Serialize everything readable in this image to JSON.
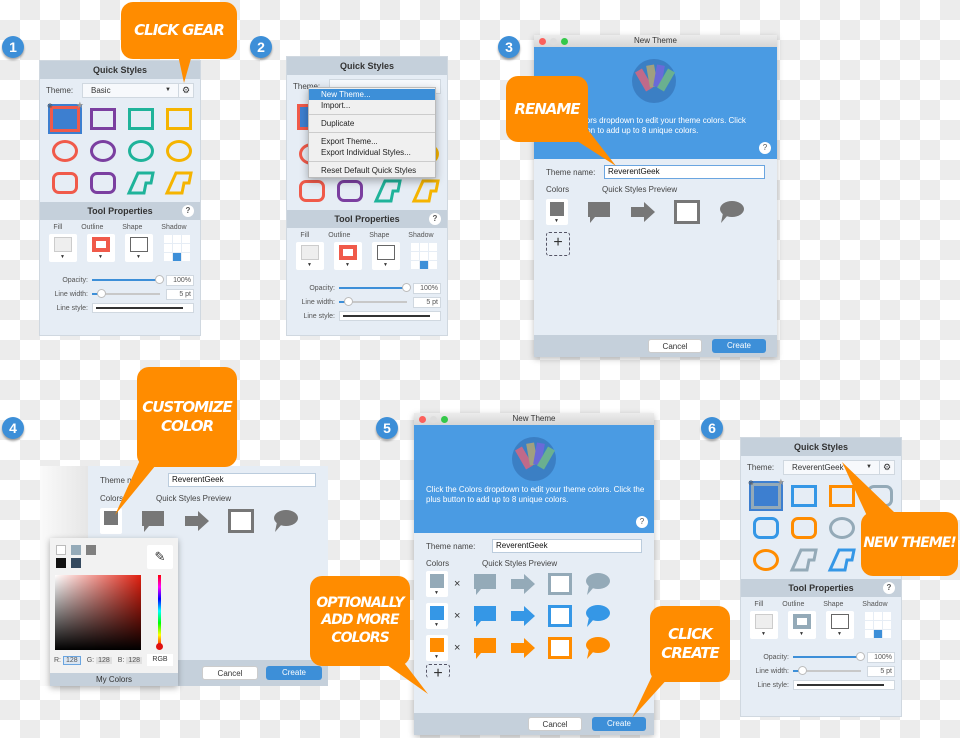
{
  "callouts": {
    "click_gear": "Click Gear",
    "rename": "Rename",
    "customize_color": [
      "Customize",
      "Color"
    ],
    "optionally_add": [
      "Optionally",
      "Add More",
      "Colors"
    ],
    "click_create": [
      "Click",
      "Create"
    ],
    "new_theme": "New Theme!"
  },
  "steps": [
    "1",
    "2",
    "3",
    "4",
    "5",
    "6"
  ],
  "colors": {
    "callout": "#ff8c00",
    "accent": "#3d8fd8",
    "banner": "#4a9be3",
    "basic_palette": [
      "#f05a4a",
      "#7b3fa0",
      "#1fb39a",
      "#f5b400"
    ],
    "custom_palette": [
      "#94aab8",
      "#3597e6",
      "#ff8c00"
    ]
  },
  "quick_styles": {
    "title": "Quick Styles",
    "theme_label": "Theme:",
    "theme_basic": "Basic",
    "theme_custom": "ReverentGeek"
  },
  "tool_properties": {
    "title": "Tool Properties",
    "help": "?",
    "columns": [
      "Fill",
      "Outline",
      "Shape",
      "Shadow"
    ],
    "opacity_label": "Opacity:",
    "opacity_value": "100%",
    "opacity_fraction": 1.0,
    "line_width_label": "Line width:",
    "line_width_value": "5 pt",
    "line_width_fraction": 0.1,
    "line_style_label": "Line style:"
  },
  "gear_menu": {
    "items": [
      "New Theme...",
      "Import...",
      "Duplicate",
      "Export Theme...",
      "Export Individual Styles...",
      "Reset Default Quick Styles"
    ],
    "highlighted": "New Theme..."
  },
  "new_theme_dialog": {
    "title": "New Theme",
    "instructions": "Click the Colors dropdown to edit your theme colors. Click the plus button to add up to 8 unique colors.",
    "instructions_partial": "lors dropdown to edit your theme colors. Click\nton to add up to 8 unique colors.",
    "theme_name_label": "Theme name:",
    "theme_name_value": "ReverentGeek",
    "theme_name_partial_label": "Theme n",
    "colors_label": "Colors",
    "preview_label": "Quick Styles Preview",
    "cancel": "Cancel",
    "create": "Create",
    "remove": "×",
    "add": "+"
  },
  "color_picker": {
    "r_label": "R:",
    "r": "128",
    "g_label": "G:",
    "g": "128",
    "b_label": "B:",
    "b": "128",
    "mode": "RGB",
    "my_colors": "My Colors",
    "swatches": [
      "#ffffff",
      "#94aab8",
      "#808080",
      "#111111",
      "#34495e"
    ]
  }
}
